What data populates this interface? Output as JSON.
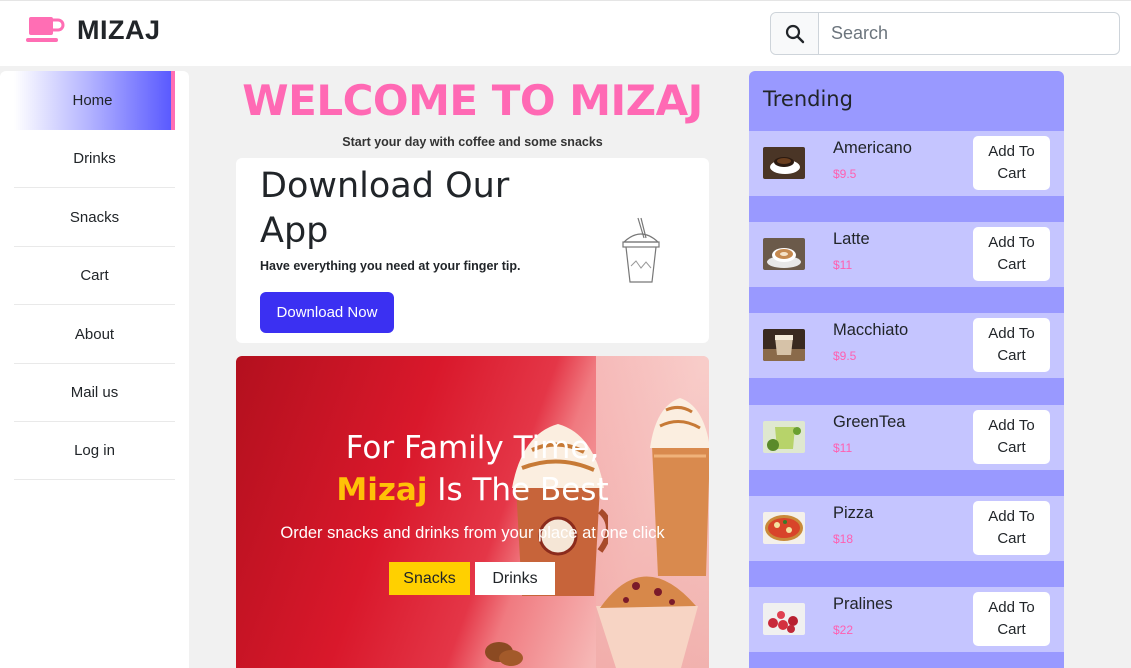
{
  "header": {
    "brand": "MIZAJ",
    "logo_icon": "coffee-cup-icon",
    "search_icon": "search-icon",
    "search_placeholder": "Search"
  },
  "sidebar": {
    "items": [
      {
        "label": "Home",
        "active": true
      },
      {
        "label": "Drinks",
        "active": false
      },
      {
        "label": "Snacks",
        "active": false
      },
      {
        "label": "Cart",
        "active": false
      },
      {
        "label": "About",
        "active": false
      },
      {
        "label": "Mail us",
        "active": false
      },
      {
        "label": "Log in",
        "active": false
      }
    ]
  },
  "main": {
    "welcome": "WELCOME TO MIZAJ",
    "tagline": "Start your day with coffee and some snacks",
    "promo": {
      "title": "Download Our App",
      "subtitle": "Have everything you need at your finger tip.",
      "button": "Download Now"
    },
    "hero": {
      "line1": "For Family Time,",
      "highlight": "Mizaj",
      "line2_rest": " Is The Best",
      "subtitle": "Order snacks and drinks from your place at one click",
      "snacks_button": "Snacks",
      "drinks_button": "Drinks"
    }
  },
  "trending": {
    "title": "Trending",
    "add_label": "Add To Cart",
    "items": [
      {
        "name": "Americano",
        "price": "$9.5"
      },
      {
        "name": "Latte",
        "price": "$11"
      },
      {
        "name": "Macchiato",
        "price": "$9.5"
      },
      {
        "name": "GreenTea",
        "price": "$11"
      },
      {
        "name": "Pizza",
        "price": "$18"
      },
      {
        "name": "Pralines",
        "price": "$22"
      }
    ]
  },
  "colors": {
    "accent_pink": "#ff69b4",
    "primary_blue": "#3b30f2",
    "trending_bg": "#9999ff",
    "trending_item_bg": "#c5c5ff",
    "snacks_yellow": "#ffd000"
  }
}
